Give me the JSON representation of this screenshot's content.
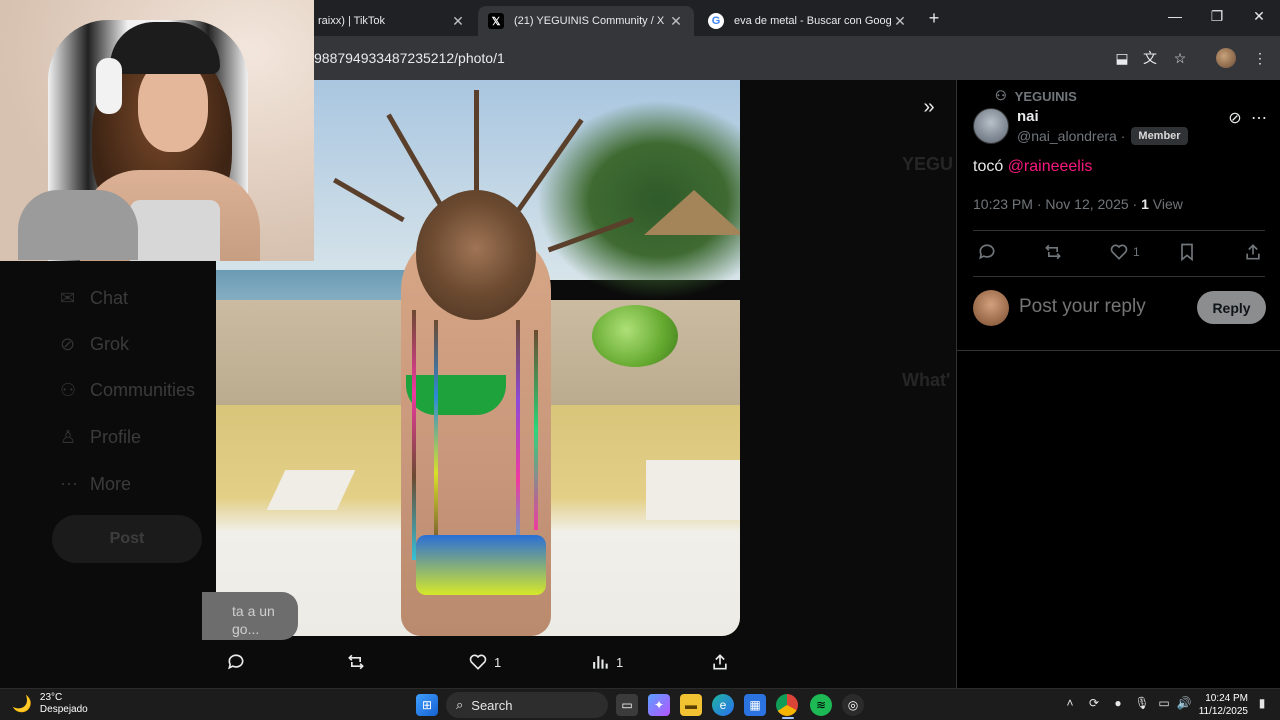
{
  "browser": {
    "tabs": [
      {
        "label": "raixx) | TikTok",
        "icon": "tiktok-icon"
      },
      {
        "label": "(21) YEGUINIS Community / X",
        "icon": "x-logo-icon",
        "active": true
      },
      {
        "label": "eva de metal - Buscar con Google",
        "icon": "google-icon"
      }
    ],
    "url": "988794933487235212/photo/1"
  },
  "page": {
    "dim_nav": [
      "Chat",
      "Grok",
      "Communities",
      "Profile",
      "More"
    ],
    "dim_post_label": "Post",
    "caption_bubble": "ta a un\ngo...",
    "photo_actions": {
      "like_count": "1",
      "view_count": "1"
    }
  },
  "tweet": {
    "community": "YEGUINIS",
    "username": "nai",
    "handle": "@nai_alondrera",
    "badge": "Member",
    "text_prefix": "tocó ",
    "mention": "@raineeelis",
    "time": "10:23 PM · Nov 12, 2025 · ",
    "views_count": "1",
    "views_label": " View",
    "like_count": "1",
    "reply_placeholder": "Post your reply",
    "reply_button": "Reply"
  },
  "taskbar": {
    "temperature": "23°C",
    "condition": "Despejado",
    "search_label": "Search",
    "time": "10:24 PM",
    "date": "11/12/2025"
  },
  "colors": {
    "mention": "#f91880",
    "background": "#000000",
    "muted": "#71767b"
  }
}
